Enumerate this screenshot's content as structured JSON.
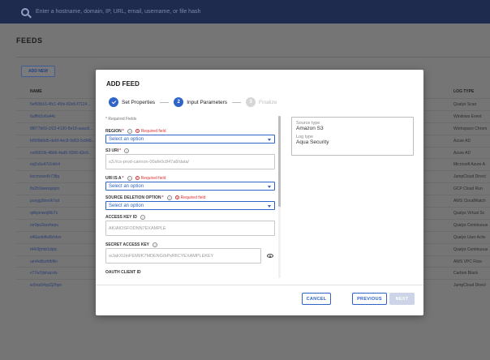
{
  "search": {
    "placeholder": "Enter a hostname, domain, IP, URL, email, username, or file hash"
  },
  "page": {
    "title": "FEEDS",
    "add_new_label": "ADD NEW",
    "columns": {
      "name": "NAME",
      "log_type": "LOG TYPE"
    },
    "rows": [
      {
        "name": "5ef93b16-4fc1-45fe-82e5-f7124...",
        "status": "",
        "source": "",
        "log_type": "Qualys Scan"
      },
      {
        "name": "6uffht2o6u44c",
        "status": "",
        "source": "",
        "log_type": "Windows Event"
      },
      {
        "name": "8f877b69-1f22-4120-8e18-aaac8...",
        "status": "",
        "source": "",
        "log_type": "Workspace Chrom"
      },
      {
        "name": "b05f9b8d5-de6f-4ec8-9d03-5c848...",
        "status": "",
        "source": "",
        "log_type": "Azure AD"
      },
      {
        "name": "ce6681fb-48d6-4ad5-9266-d2e9...",
        "status": "",
        "source": "",
        "log_type": "Azure AD"
      },
      {
        "name": "eq2u6u47i2okh4",
        "status": "",
        "source": "",
        "log_type": "Microsoft Azure A"
      },
      {
        "name": "kocmzwo6r73fjq",
        "status": "",
        "source": "",
        "log_type": "JumpCloud Direct"
      },
      {
        "name": "8s2fr0weoqxipm",
        "status": "",
        "source": "",
        "log_type": "GCP Cloud Run"
      },
      {
        "name": "pcegg3tmvlk7sd",
        "status": "",
        "source": "",
        "log_type": "AWS CloudWatch"
      },
      {
        "name": "qdkpinwoj8ib7s",
        "status": "",
        "source": "",
        "log_type": "Qualys Virtual Sc"
      },
      {
        "name": "rsr9pu3arzhepu",
        "status": "",
        "source": "",
        "log_type": "Qualys Continuous"
      },
      {
        "name": "s46auhdlw8chtvv",
        "status": "",
        "source": "",
        "log_type": "Qualys User Activ"
      },
      {
        "name": "t44r9jrmb1dptc",
        "status": "",
        "source": "",
        "log_type": "Qualys Continuous"
      },
      {
        "name": "um4o6bzhfbflin",
        "status": "",
        "source": "",
        "log_type": "AWS VPC Flow"
      },
      {
        "name": "v77w7jlshacvts",
        "status": "Archived",
        "source": "Amazon S3",
        "log_type": "Carbon Black"
      },
      {
        "name": "w2ma54zp2j2hpn",
        "status": "Archived",
        "source": "Amazon S3",
        "log_type": "JumpCloud Direct"
      }
    ]
  },
  "modal": {
    "title": "ADD FEED",
    "steps": [
      {
        "number": "1",
        "label": "Set Properties"
      },
      {
        "number": "2",
        "label": "Input Parameters"
      },
      {
        "number": "3",
        "label": "Finalize"
      }
    ],
    "required_note": "* Required Fields",
    "fields": {
      "region": {
        "label": "REGION",
        "error": "Required field",
        "value": "Select an option"
      },
      "s3_uri": {
        "label": "S3 URI",
        "value": "s3://cs-prod-cannon-00afe0c847a8/data/"
      },
      "uri_is_a": {
        "label": "URI IS A",
        "error": "Required field",
        "value": "Select an option"
      },
      "source_deletion": {
        "label": "SOURCE DELETION OPTION",
        "error": "Required field",
        "value": "Select an option"
      },
      "access_key_id": {
        "label": "ACCESS KEY ID",
        "value": "AKIAIOSFODNN7EXAMPLE"
      },
      "secret_access_key": {
        "label": "SECRET ACCESS KEY",
        "value": "wJalrXUtnFEMI/K7MDENG/bPxRfiCYEXAMPLEKEY"
      },
      "oauth_client_id": {
        "label": "OAUTH CLIENT ID"
      }
    },
    "info": {
      "source_type_key": "Source type",
      "source_type_value": "Amazon S3",
      "log_type_key": "Log type",
      "log_type_value": "Aqua Security"
    },
    "buttons": {
      "cancel": "CANCEL",
      "previous": "PREVIOUS",
      "next": "NEXT"
    }
  },
  "colors": {
    "accent": "#2e63c7",
    "topbar": "#1f2a4f",
    "error": "#d33333"
  }
}
